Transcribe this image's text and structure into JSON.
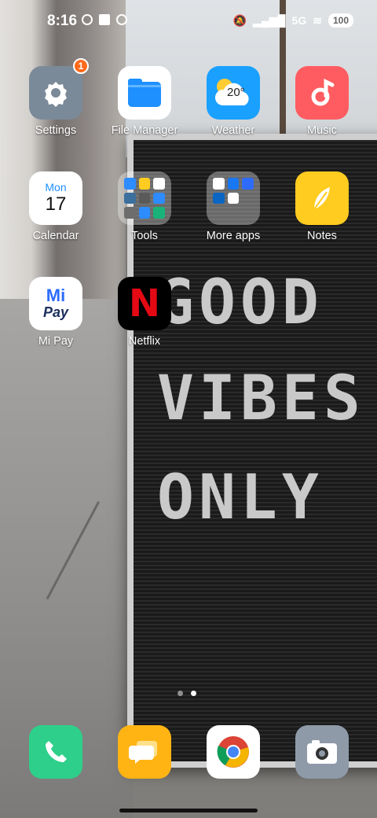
{
  "status": {
    "time": "8:16",
    "network": "5G",
    "battery": "100"
  },
  "wallpaper": {
    "lines": [
      "GOOD",
      "VIBES",
      "ONLY"
    ]
  },
  "apps": [
    {
      "id": "settings",
      "label": "Settings",
      "badge": "1"
    },
    {
      "id": "file-manager",
      "label": "File Manager"
    },
    {
      "id": "weather",
      "label": "Weather",
      "temp": "20°"
    },
    {
      "id": "music",
      "label": "Music"
    },
    {
      "id": "calendar",
      "label": "Calendar",
      "day_name": "Mon",
      "day_num": "17"
    },
    {
      "id": "tools",
      "label": "Tools"
    },
    {
      "id": "more-apps",
      "label": "More apps"
    },
    {
      "id": "notes",
      "label": "Notes"
    },
    {
      "id": "mi-pay",
      "label": "Mi Pay",
      "logo_top": "Mi",
      "logo_bottom": "Pay"
    },
    {
      "id": "netflix",
      "label": "Netflix",
      "logo": "N"
    }
  ],
  "dock": [
    {
      "id": "phone",
      "icon": "phone-icon"
    },
    {
      "id": "messages",
      "icon": "messages-icon"
    },
    {
      "id": "chrome",
      "icon": "chrome-icon"
    },
    {
      "id": "camera",
      "icon": "camera-icon"
    }
  ],
  "colors": {
    "settings": "#7b8a99",
    "file_manager": "#1e90ff",
    "weather": "#1aa0ff",
    "music": "#ff5c61",
    "notes": "#ffcc1f",
    "netflix": "#e50914",
    "phone": "#2ecf8a",
    "messages": "#ffb414",
    "camera": "#8e9aa8"
  },
  "pager": {
    "pages": 2,
    "active": 1
  }
}
